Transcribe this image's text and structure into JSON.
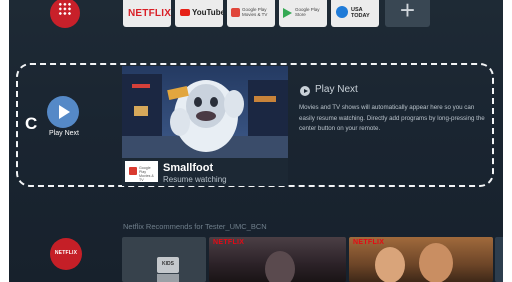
{
  "top_apps": {
    "netflix": "NETFLIX",
    "youtube": "YouTube",
    "google_play_movies": "Google Play Movies & TV",
    "google_play_store": "Google Play Store",
    "usa_today": "USA TODAY",
    "add": "+"
  },
  "focus_row": {
    "letter": "C",
    "channel_label": "Play Next",
    "card": {
      "title": "Smallfoot",
      "subtitle": "Resume watching",
      "app_logo_text": "Google Play Movies & TV"
    },
    "info": {
      "heading": "Play Next",
      "description": "Movies and TV shows will automatically appear here so you can easily resume watching. Directly add programs by long-pressing the center button on your remote."
    }
  },
  "recommendations": {
    "title": "Netflix Recommends for Tester_UMC_BCN",
    "channel_label": "NETFLIX",
    "cards": [
      {
        "badge": "KIDS"
      },
      {
        "badge": "NETFLIX"
      },
      {
        "badge": "NETFLIX"
      }
    ]
  },
  "colors": {
    "background": "#1a2531",
    "play_next_accent": "#5589c7",
    "netflix_red": "#e50914"
  }
}
